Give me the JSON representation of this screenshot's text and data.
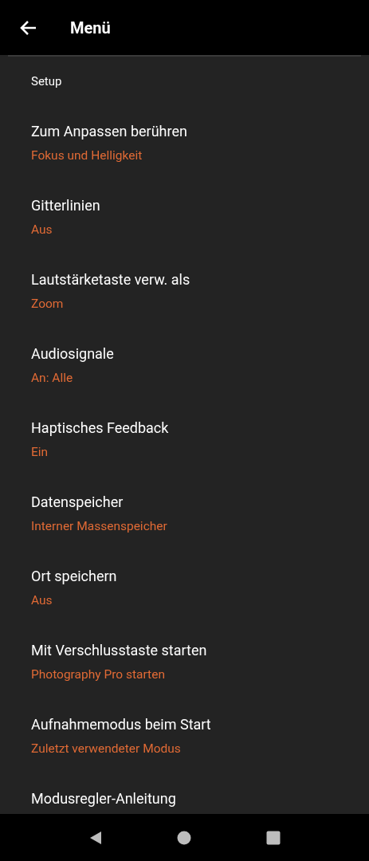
{
  "header": {
    "title": "Menü"
  },
  "section": {
    "title": "Setup"
  },
  "items": [
    {
      "title": "Zum Anpassen berühren",
      "value": "Fokus und Helligkeit"
    },
    {
      "title": "Gitterlinien",
      "value": "Aus"
    },
    {
      "title": "Lautstärketaste verw. als",
      "value": "Zoom"
    },
    {
      "title": "Audiosignale",
      "value": "An: Alle"
    },
    {
      "title": "Haptisches Feedback",
      "value": "Ein"
    },
    {
      "title": "Datenspeicher",
      "value": "Interner Massenspeicher"
    },
    {
      "title": "Ort speichern",
      "value": "Aus"
    },
    {
      "title": "Mit Verschlusstaste starten",
      "value": "Photography Pro starten"
    },
    {
      "title": "Aufnahmemodus beim Start",
      "value": "Zuletzt verwendeter Modus"
    },
    {
      "title": "Modusregler-Anleitung"
    }
  ]
}
